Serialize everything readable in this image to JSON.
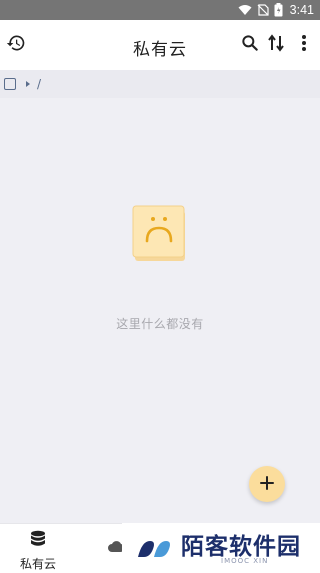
{
  "status_bar": {
    "time": "3:41"
  },
  "app_bar": {
    "title": "私有云"
  },
  "path_bar": {
    "path": "/"
  },
  "content": {
    "empty_message": "这里什么都没有"
  },
  "fab": {
    "label": "+"
  },
  "bottom_nav": {
    "items": [
      {
        "label": "私有云"
      }
    ]
  },
  "watermark": {
    "brand": "陌客软件园",
    "sub": "IMOOC XIN"
  },
  "colors": {
    "accent": "#fbdd9c",
    "icon": "#e8a81e"
  }
}
